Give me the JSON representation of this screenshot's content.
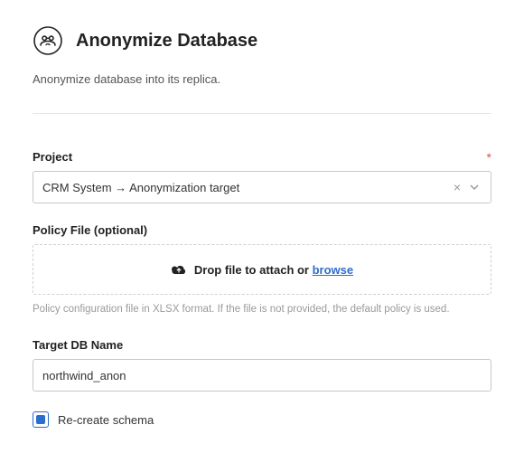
{
  "header": {
    "title": "Anonymize Database",
    "subtitle": "Anonymize database into its replica."
  },
  "project": {
    "label": "Project",
    "required_marker": "*",
    "value": "CRM System → Anonymization target"
  },
  "policy": {
    "label": "Policy File (optional)",
    "drop_text": "Drop file to attach or ",
    "browse_text": "browse",
    "helper": "Policy configuration file in XLSX format. If the file is not provided, the default policy is used."
  },
  "target": {
    "label": "Target DB Name",
    "value": "northwind_anon"
  },
  "recreate": {
    "label": "Re-create schema",
    "checked": true
  }
}
